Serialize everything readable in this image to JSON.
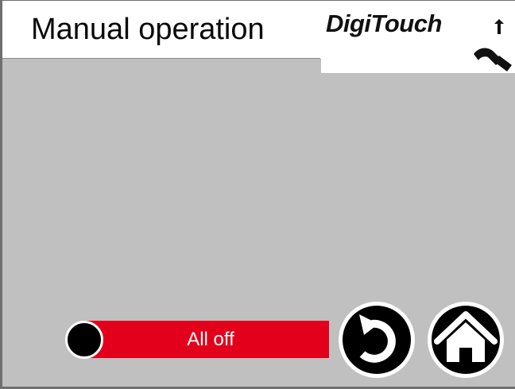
{
  "header": {
    "title": "Manual operation",
    "logo_text": "DigiTouch"
  },
  "controls": {
    "all_off_label": "All off",
    "indicator_state": "off"
  },
  "navigation": {
    "back_icon": "back-arrow-icon",
    "home_icon": "home-icon"
  },
  "colors": {
    "background": "#c0c0c0",
    "accent": "#e3001b",
    "indicator": "#000000"
  }
}
